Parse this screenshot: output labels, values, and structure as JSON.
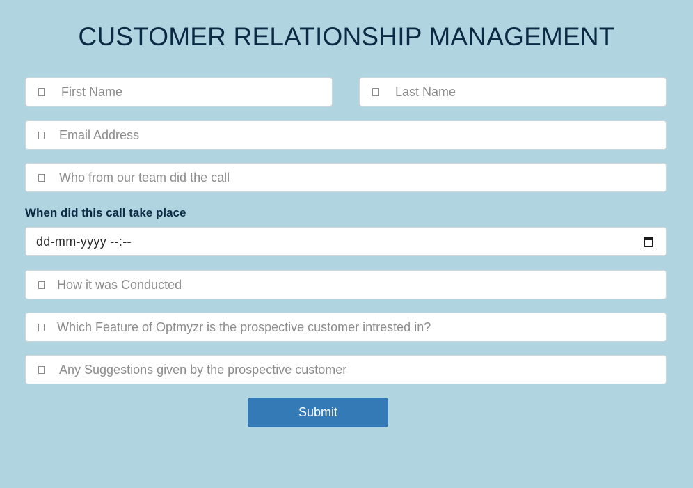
{
  "header": {
    "title": "CUSTOMER RELATIONSHIP MANAGEMENT"
  },
  "form": {
    "first_name": {
      "placeholder": "First Name",
      "icon": "user-icon"
    },
    "last_name": {
      "placeholder": "Last Name",
      "icon": "user-icon"
    },
    "email": {
      "placeholder": "Email Address",
      "icon": "envelope-icon"
    },
    "team_member": {
      "placeholder": "Who from our team did the call",
      "icon": "user-icon"
    },
    "call_date": {
      "label": "When did this call take place",
      "value_display": "dd-mm-yyyy --:--",
      "icon": "calendar-icon"
    },
    "conducted": {
      "placeholder": "How it was Conducted",
      "icon": "pencil-icon"
    },
    "feature": {
      "placeholder": "Which Feature of Optmyzr is the prospective customer intrested in?",
      "icon": "pencil-icon"
    },
    "suggestions": {
      "placeholder": "Any Suggestions given by the prospective customer",
      "icon": "comment-icon"
    },
    "submit_label": "Submit"
  },
  "colors": {
    "background": "#b1d4e1",
    "title_text": "#0c2a43",
    "button_primary": "#337ab7",
    "placeholder_text": "#8c8c8c"
  }
}
